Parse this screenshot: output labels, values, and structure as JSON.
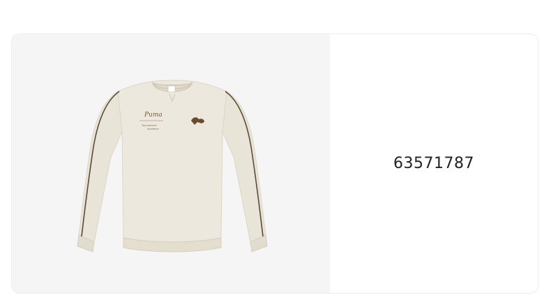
{
  "product": {
    "image_alt": "cream crewneck sweatshirt",
    "product_id": "63571787",
    "garment_color": "#e9e4d8",
    "piping_color": "#5a4a36",
    "chest_logo_text": "Puma",
    "chest_small_text": "Tournament Academy"
  },
  "colors": {
    "image_background": "#f5f5f5",
    "card_border": "#ececec",
    "text": "#222222"
  }
}
